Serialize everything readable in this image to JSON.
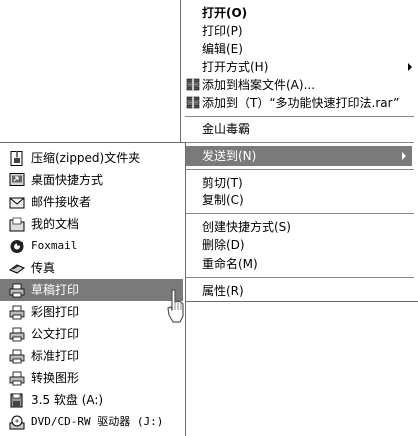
{
  "context_menu": {
    "items": [
      {
        "label": "打开(O)"
      },
      {
        "label": "打印(P)"
      },
      {
        "label": "编辑(E)"
      },
      {
        "label": "打开方式(H)"
      },
      {
        "label": "添加到档案文件(A)..."
      },
      {
        "label": "添加到（T）“多功能快速打印法.rar”"
      },
      {
        "label": "金山毒霸"
      },
      {
        "label": "发送到(N)"
      },
      {
        "label": "剪切(T)"
      },
      {
        "label": "复制(C)"
      },
      {
        "label": "创建快捷方式(S)"
      },
      {
        "label": "删除(D)"
      },
      {
        "label": "重命名(M)"
      },
      {
        "label": "属性(R)"
      }
    ]
  },
  "send_to_menu": {
    "items": [
      {
        "label": "压缩(zipped)文件夹",
        "icon": "zip-folder-icon"
      },
      {
        "label": "桌面快捷方式",
        "icon": "desktop-shortcut-icon"
      },
      {
        "label": "邮件接收者",
        "icon": "mail-icon"
      },
      {
        "label": "我的文档",
        "icon": "folder-icon"
      },
      {
        "label": "Foxmail",
        "icon": "foxmail-icon"
      },
      {
        "label": "传真",
        "icon": "fax-icon"
      },
      {
        "label": "草稿打印",
        "icon": "printer-icon"
      },
      {
        "label": "彩图打印",
        "icon": "printer-icon"
      },
      {
        "label": "公文打印",
        "icon": "printer-icon"
      },
      {
        "label": "标准打印",
        "icon": "printer-icon"
      },
      {
        "label": "转换图形",
        "icon": "printer-icon"
      },
      {
        "label": "3.5 软盘 (A:)",
        "icon": "floppy-disk-icon"
      },
      {
        "label": "DVD/CD-RW 驱动器 (J:)",
        "icon": "cd-drive-icon"
      }
    ]
  },
  "colors": {
    "highlight": "#7a7a7a",
    "border": "#6b6b6b"
  }
}
